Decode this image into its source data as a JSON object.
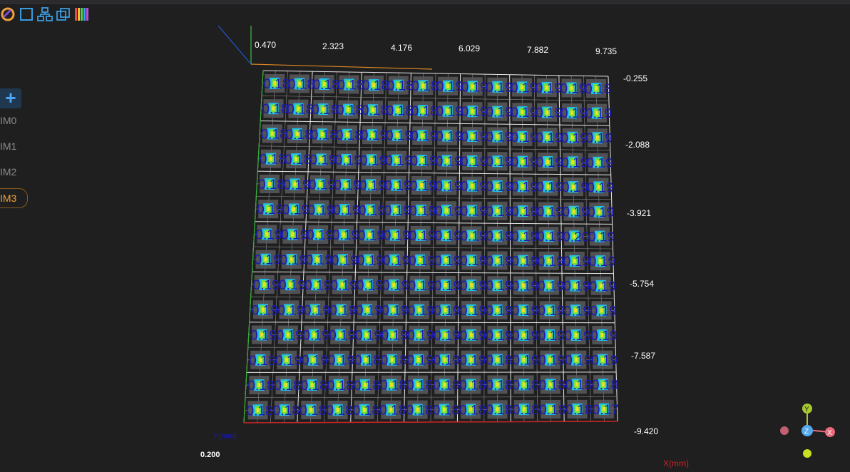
{
  "sidebar": {
    "add_label": "+",
    "items": [
      {
        "label": "IM0",
        "active": false
      },
      {
        "label": "IM1",
        "active": false
      },
      {
        "label": "IM2",
        "active": false
      },
      {
        "label": "IM3",
        "active": true
      }
    ]
  },
  "plot": {
    "x_ticks": [
      "0.470",
      "2.323",
      "4.176",
      "6.029",
      "7.882",
      "9.735"
    ],
    "y_ticks": [
      "-0.255",
      "-2.088",
      "-3.921",
      "-5.754",
      "-7.587",
      "-9.420"
    ],
    "x_axis_label": "X(mm)",
    "y_axis_label": "Y(mm)",
    "bottom_left_value": "0.200",
    "grid_rows": 14,
    "grid_cols": 14
  },
  "cell_values": [
    [
      "0.18",
      "0.18",
      "0.18",
      "0.18",
      "0.18",
      "0.18",
      "0.18",
      "0.19",
      "0.19",
      "0.19",
      "0.19",
      "0.19",
      "0.19",
      "0.18"
    ],
    [
      "0.18",
      "0.18",
      "0.18",
      "0.18",
      "0.18",
      "0.18",
      "0.18",
      "0.19",
      "0.19",
      "0.19",
      "0.19",
      "0.19",
      "0.19",
      "0.19"
    ],
    [
      "0.18",
      "0.18",
      "0.18",
      "0.18",
      "0.19",
      "0.19",
      "0.19",
      "0.19",
      "0.19",
      "0.19",
      "0.19",
      "0.19",
      "0.19",
      "0.19"
    ],
    [
      "0.18",
      "0.18",
      "0.19",
      "0.19",
      "0.19",
      "0.19",
      "0.19",
      "0.19",
      "0.19",
      "0.19",
      "0.19",
      "0.19",
      "0.19",
      "0.19"
    ],
    [
      "0.18",
      "0.19",
      "0.19",
      "0.19",
      "0.19",
      "0.19",
      "0.19",
      "0.19",
      "0.19",
      "0.19",
      "0.19",
      "0.19",
      "0.19",
      "0.19"
    ],
    [
      "0.19",
      "0.19",
      "0.19",
      "0.19",
      "0.19",
      "0.19",
      "0.19",
      "0.19",
      "0.19",
      "0.19",
      "0.19",
      "0.19",
      "0.19",
      "0.19"
    ],
    [
      "0.19",
      "0.19",
      "0.19",
      "0.19",
      "0.19",
      "0.19",
      "0.19",
      "0.19",
      "0.19",
      "0.19",
      "0.19",
      "0.19",
      "0.20",
      "0.19"
    ],
    [
      "0.19",
      "0.19",
      "0.19",
      "0.19",
      "0.19",
      "0.19",
      "0.19",
      "0.19",
      "0.19",
      "0.19",
      "0.19",
      "0.19",
      "0.19",
      "0.19"
    ],
    [
      "0.19",
      "0.19",
      "0.19",
      "0.19",
      "0.19",
      "0.19",
      "0.19",
      "0.19",
      "0.19",
      "0.19",
      "0.19",
      "0.19",
      "0.19",
      "0.19"
    ],
    [
      "0.19",
      "0.19",
      "0.19",
      "0.19",
      "0.19",
      "0.19",
      "0.19",
      "0.19",
      "0.19",
      "0.19",
      "0.19",
      "0.19",
      "0.19",
      "0.19"
    ],
    [
      "0.19",
      "0.19",
      "0.19",
      "0.19",
      "0.19",
      "0.19",
      "0.19",
      "0.19",
      "0.19",
      "0.19",
      "0.19",
      "0.19",
      "0.19",
      "0.19"
    ],
    [
      "0.18",
      "0.19",
      "0.19",
      "0.19",
      "0.18",
      "0.18",
      "0.19",
      "0.19",
      "0.19",
      "0.18",
      "0.19",
      "0.19",
      "0.19",
      "0.19"
    ],
    [
      "0.18",
      "0.18",
      "0.18",
      "0.18",
      "0.18",
      "0.18",
      "0.18",
      "0.18",
      "0.18",
      "0.18",
      "0.18",
      "0.18",
      "0.18",
      "0.18"
    ],
    [
      "0.18",
      "0.18",
      "0.18",
      "0.18",
      "0.18",
      "0.18",
      "0.18",
      "0.18",
      "0.18",
      "0.18",
      "0.18",
      "0.18",
      "0.18",
      "0.17"
    ]
  ],
  "orientation_gizmo": {
    "y_label": "Y",
    "z_label": "Z",
    "x_label": "X",
    "colors": {
      "y": "#a8c830",
      "z": "#55aaee",
      "x": "#e86a7a",
      "neg_x": "#c06070",
      "neg_y": "#c8e020"
    }
  },
  "colors": {
    "background": "#1f1f20",
    "grid": "#d8d8d8",
    "accent": "#f0a23a",
    "text_blue": "#1a1ab4"
  }
}
